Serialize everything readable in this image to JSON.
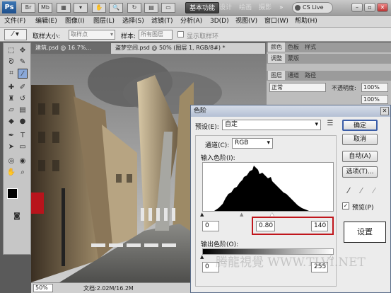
{
  "topbar": {
    "logo": "Ps",
    "workspaces": [
      "基本功能",
      "设计",
      "绘画",
      "摄影"
    ],
    "cs_live": "CS Live"
  },
  "menu": [
    "文件(F)",
    "编辑(E)",
    "图像(I)",
    "图层(L)",
    "选择(S)",
    "滤镜(T)",
    "分析(A)",
    "3D(D)",
    "视图(V)",
    "窗口(W)",
    "帮助(H)"
  ],
  "options": {
    "sample_size_label": "取样大小:",
    "sample_size_value": "取样点",
    "sample_label": "样本:",
    "sample_value": "所有图层",
    "show_ring_label": "显示取样环"
  },
  "tabs": [
    "建筑.psd @ 16.7%...",
    "盗梦空间.psd @ 50% (图层 1, RGB/8#) *"
  ],
  "status": {
    "zoom": "50%",
    "doc": "文档:2.02M/16.2M"
  },
  "panels": {
    "row1": [
      "颜色",
      "色板",
      "样式"
    ],
    "row2": [
      "调整",
      "蒙版"
    ],
    "row3": [
      "图层",
      "通道",
      "路径"
    ],
    "blend_mode": "正常",
    "opacity_label": "不透明度:",
    "opacity_value": "100%",
    "fill_value": "100%"
  },
  "dialog": {
    "title": "色阶",
    "preset_label": "预设(E):",
    "preset_value": "自定",
    "channel_label": "通道(C):",
    "channel_value": "RGB",
    "input_label": "输入色阶(I):",
    "input_black": "0",
    "input_gray": "0.80",
    "input_white": "140",
    "output_label": "输出色阶(O):",
    "output_black": "0",
    "output_white": "255",
    "ok": "确定",
    "cancel": "取消",
    "auto": "自动(A)",
    "options": "选项(T)...",
    "preview_label": "预览(P)",
    "annotation": "设置"
  },
  "watermark": "腾龍視覺 WWW.TLVI.NET",
  "accent_colors": {
    "highlight_box": "#c0161c",
    "ok_button_border": "#3a5da8"
  }
}
